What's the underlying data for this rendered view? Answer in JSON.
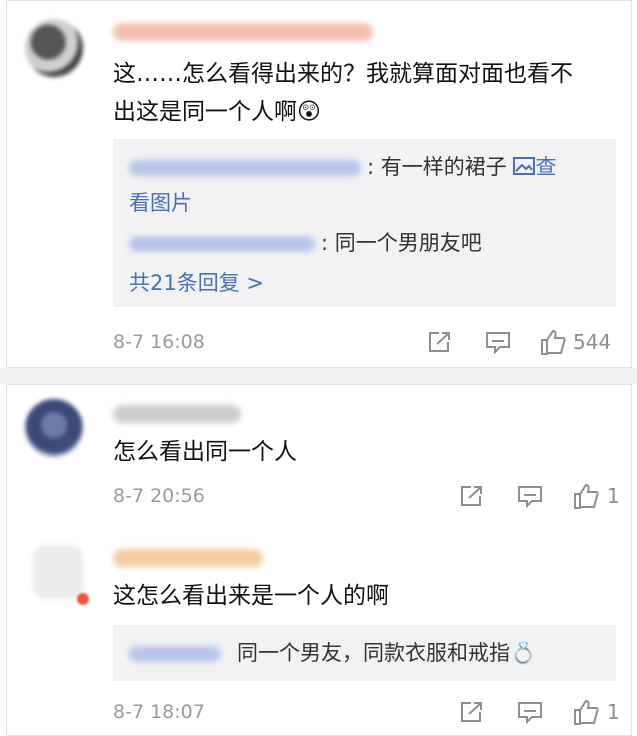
{
  "comments": [
    {
      "text_line1": "这……怎么看得出来的？我就算面对面也看不",
      "text_line2": "出这是同一个人啊",
      "emoji": "😲",
      "replies": [
        {
          "text": ": 有一样的裙子",
          "link": "查",
          "link2": "看图片"
        },
        {
          "text": ": 同一个男朋友吧"
        }
      ],
      "more_replies": "共21条回复 >",
      "time": "8-7 16:08",
      "likes": "544"
    },
    {
      "text": "怎么看出同一个人",
      "time": "8-7 20:56",
      "likes": "1"
    },
    {
      "text": "这怎么看出来是一个人的啊",
      "reply": "同一个男友，同款衣服和戒指",
      "emoji": "💍",
      "time": "8-7 18:07",
      "likes": "1"
    }
  ],
  "icons": [
    "share-icon",
    "comment-icon",
    "like-icon",
    "image-icon"
  ],
  "colors": {
    "link": "#4a6fb3",
    "meta": "#9a9a9a",
    "reply_bg": "#f2f2f4"
  }
}
